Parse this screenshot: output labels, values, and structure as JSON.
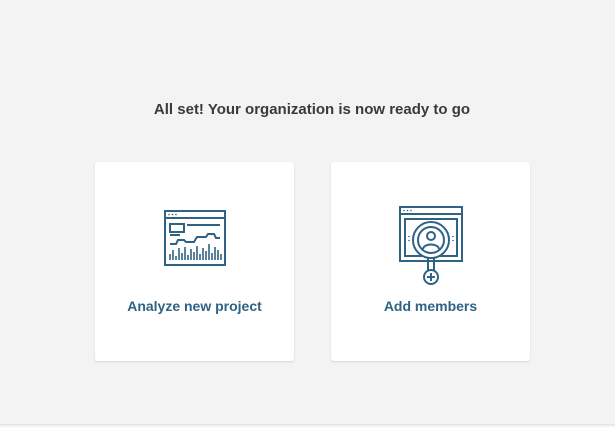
{
  "message": {
    "title": "All set! Your organization is now ready to go"
  },
  "cards": [
    {
      "label": "Analyze new project",
      "icon": "analytics-window-icon"
    },
    {
      "label": "Add members",
      "icon": "user-search-icon"
    }
  ],
  "colors": {
    "background": "#f3f3f3",
    "card": "#ffffff",
    "icon": "#2f6283",
    "label": "#2f6283",
    "title": "#3a3a3a"
  }
}
